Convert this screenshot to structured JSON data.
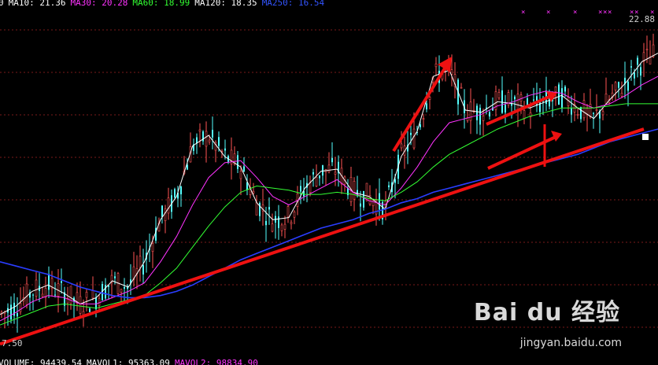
{
  "chart_data": {
    "type": "candlestick",
    "title": "",
    "indicators": [
      {
        "name": "MA10",
        "value": "21.36",
        "color": "#ffffff"
      },
      {
        "name": "MA30",
        "value": "20.28",
        "color": "#ff33ff"
      },
      {
        "name": "MA60",
        "value": "18.99",
        "color": "#33ff33"
      },
      {
        "name": "MA120",
        "value": "18.35",
        "color": "#ffffff"
      },
      {
        "name": "MA250",
        "value": "16.54",
        "color": "#3355ff"
      }
    ],
    "ma_legend_prefix": "0",
    "y_high_label": "22.88",
    "y_low_label": "7.50",
    "ylim": [
      7.5,
      22.88
    ],
    "volume_legend": [
      {
        "name": "VOLUME",
        "value": "94439.54",
        "color": "#ffffff"
      },
      {
        "name": "MAVOL1",
        "value": "95363.09",
        "color": "#ffffff"
      },
      {
        "name": "MAVOL2",
        "value": "98834.90",
        "color": "#ff33ff"
      }
    ],
    "series": [
      {
        "name": "MA10",
        "values": [
          9.0,
          9.4,
          10.1,
          10.4,
          10.0,
          9.5,
          9.8,
          10.6,
          10.3,
          11.5,
          13.5,
          14.6,
          17.0,
          17.5,
          16.5,
          16.0,
          14.3,
          13.5,
          13.6,
          15.0,
          15.8,
          15.9,
          14.8,
          14.6,
          14.0,
          16.5,
          17.7,
          20.3,
          20.6,
          18.7,
          18.6,
          19.1,
          19.0,
          18.8,
          19.1,
          19.4,
          18.8,
          18.3,
          19.2,
          20.0,
          21.0,
          21.4
        ]
      },
      {
        "name": "MA30",
        "values": [
          8.7,
          9.1,
          9.6,
          9.9,
          9.8,
          9.5,
          9.5,
          9.8,
          10.1,
          10.5,
          11.5,
          12.7,
          14.2,
          15.5,
          16.2,
          16.3,
          15.5,
          14.6,
          14.2,
          14.6,
          15.0,
          15.4,
          14.8,
          14.4,
          14.2,
          15.0,
          16.0,
          17.2,
          18.1,
          18.3,
          18.5,
          18.9,
          19.1,
          19.4,
          19.6,
          19.5,
          19.1,
          18.8,
          19.0,
          19.4,
          19.9,
          20.3
        ]
      },
      {
        "name": "MA60",
        "values": [
          8.5,
          8.8,
          9.1,
          9.4,
          9.5,
          9.4,
          9.3,
          9.5,
          9.7,
          9.9,
          10.5,
          11.2,
          12.2,
          13.2,
          14.1,
          14.8,
          15.1,
          15.0,
          14.9,
          14.7,
          14.7,
          14.8,
          14.7,
          14.5,
          14.4,
          14.8,
          15.3,
          16.0,
          16.6,
          17.0,
          17.4,
          17.8,
          18.1,
          18.4,
          18.6,
          18.8,
          18.8,
          18.8,
          18.9,
          19.0,
          19.0,
          19.0
        ]
      },
      {
        "name": "MA250",
        "values": [
          11.5,
          11.3,
          11.1,
          10.9,
          10.6,
          10.3,
          10.1,
          9.9,
          9.8,
          9.8,
          9.9,
          10.1,
          10.4,
          10.8,
          11.2,
          11.6,
          11.9,
          12.2,
          12.5,
          12.8,
          13.1,
          13.3,
          13.5,
          13.8,
          14.0,
          14.3,
          14.5,
          14.8,
          15.0,
          15.2,
          15.4,
          15.6,
          15.8,
          16.0,
          16.2,
          16.4,
          16.6,
          16.9,
          17.2,
          17.4,
          17.6,
          17.8
        ]
      },
      {
        "name": "trendline",
        "values": [
          7.6,
          17.8
        ]
      }
    ],
    "grid": true
  },
  "watermark": {
    "logo": "Bai du 经验",
    "url": "jingyan.baidu.com"
  }
}
